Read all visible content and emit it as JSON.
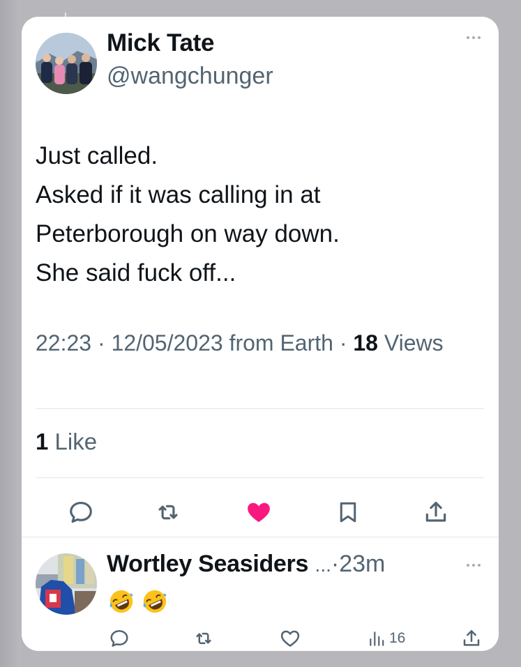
{
  "tweet": {
    "author_name": "Mick Tate",
    "author_handle": "@wangchunger",
    "text_lines": [
      "Just called.",
      "Asked if it was calling in at",
      "Peterborough on way down.",
      "She said fuck off..."
    ],
    "time": "22:23",
    "separator": "·",
    "date": "12/05/2023",
    "source": "from Earth",
    "views_count": "18",
    "views_label": "Views",
    "likes_count": "1",
    "likes_label": "Like",
    "liked": true,
    "like_color": "#f91880"
  },
  "reply": {
    "author_name": "Wortley Seasiders",
    "name_truncation": "...",
    "separator": "·",
    "time": "23m",
    "emojis": [
      "🤣",
      "🤣"
    ],
    "views_count": "16"
  },
  "icons": {
    "more": "more-horizontal-icon",
    "reply": "reply-icon",
    "retweet": "retweet-icon",
    "like": "heart-icon",
    "bookmark": "bookmark-icon",
    "share": "share-icon",
    "views": "views-icon"
  },
  "colors": {
    "text_primary": "#0f1419",
    "text_secondary": "#536471",
    "divider": "#e1e6ea",
    "backdrop": "#b7b6bb"
  }
}
